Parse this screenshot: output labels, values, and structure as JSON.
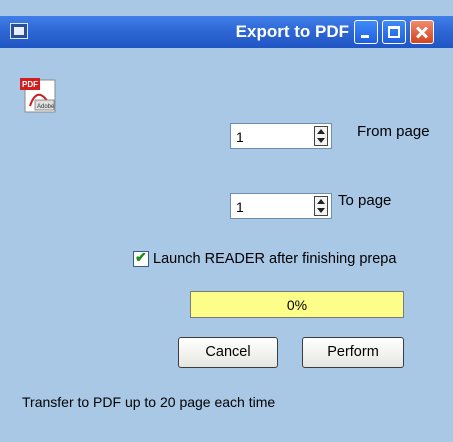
{
  "window": {
    "title": "Export to PDF",
    "app_icon": "app-window-icon",
    "controls": {
      "minimize": "minimize-icon",
      "maximize": "maximize-icon",
      "close": "close-icon"
    }
  },
  "header": {
    "icon": "pdf-adobe-icon",
    "icon_text": "PDF",
    "icon_subtext": "Adobe"
  },
  "from_page": {
    "value": "1",
    "label": "From page"
  },
  "to_page": {
    "value": "1",
    "label": "To page"
  },
  "launch_reader": {
    "checked": true,
    "label": "Launch READER after finishing prepa"
  },
  "progress": {
    "fraction": 0.0,
    "text": "0%",
    "color": "#fdfd8a"
  },
  "buttons": {
    "cancel": "Cancel",
    "perform": "Perform"
  },
  "footer": {
    "info": "Transfer to PDF up to 20 page each time"
  },
  "colors": {
    "window_bg": "#a8c8e6",
    "titlebar": "#2d66d4",
    "close_button": "#d2451f"
  }
}
